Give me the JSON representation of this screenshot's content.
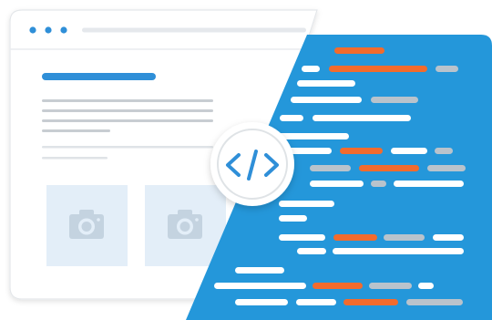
{
  "illustration": {
    "browser_window": {
      "dots": 3,
      "heading_color": "#2f8fd8",
      "image_placeholders": [
        "camera-icon",
        "camera-icon"
      ]
    },
    "code_editor": {
      "panel_color": "#2497da",
      "token_colors": {
        "plain": "#ffffff",
        "keyword": "#f26b2d",
        "comment": "#b9c3cc"
      }
    },
    "center_badge": {
      "icon": "code-brackets-icon",
      "color": "#2f8fd8"
    }
  }
}
